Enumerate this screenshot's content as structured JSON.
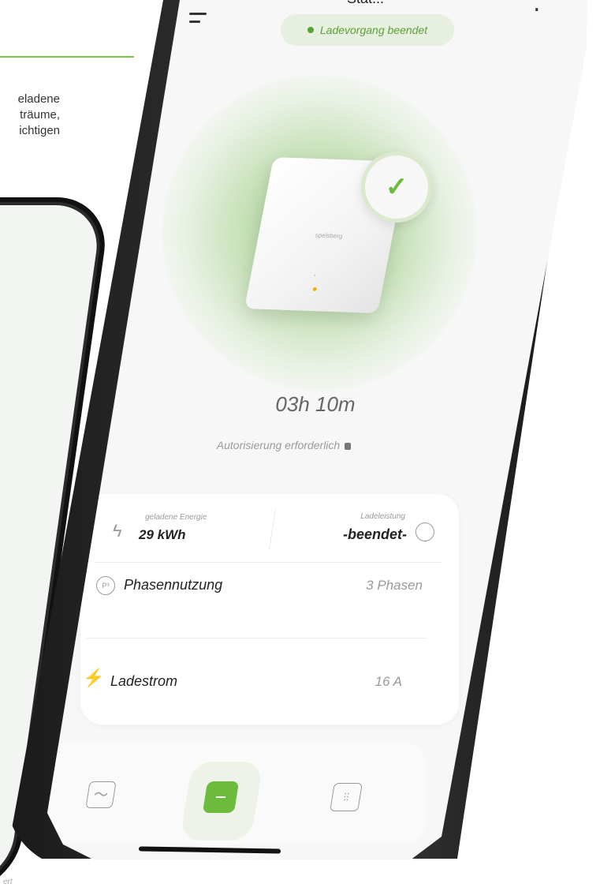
{
  "side_text": {
    "lines": [
      "eladene",
      "träume,",
      "ichtigen"
    ],
    "bottom_fragment": "ert"
  },
  "header": {
    "title_fragment": "Stat...",
    "status": "Ladevorgang beendet"
  },
  "hero": {
    "device_logo": "spelsberg",
    "duration": "03h 10m",
    "auth_note": "Autorisierung erforderlich"
  },
  "stats": {
    "energy_label": "geladene Energie",
    "energy_value": "29 kWh",
    "power_label": "Ladeleistung",
    "power_value": "-beendet-"
  },
  "rows": [
    {
      "label": "Phasennutzung",
      "value": "3 Phasen"
    },
    {
      "label": "Ladestrom",
      "value": "16 A"
    }
  ],
  "nav": {
    "items": [
      "statistics",
      "wallbox",
      "settings"
    ],
    "active": "wallbox"
  },
  "colors": {
    "accent": "#6cbb3c",
    "status_bg": "#e7efe0",
    "screen_bg": "#f6f7f6"
  }
}
